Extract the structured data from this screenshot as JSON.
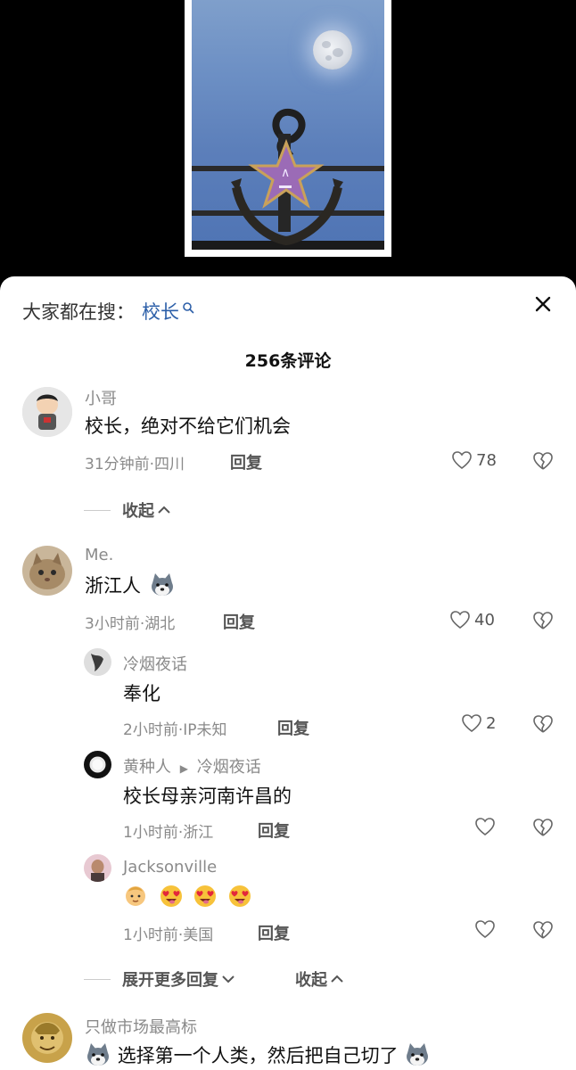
{
  "search": {
    "label": "大家都在搜：",
    "term": "校长"
  },
  "comments_title": "256条评论",
  "comments": [
    {
      "user": "小哥",
      "text": "校长，绝对不给它们机会",
      "time": "31分钟前·四川",
      "reply": "回复",
      "likes": "78",
      "collapse": "收起"
    },
    {
      "user": "Me.",
      "text": "浙江人",
      "time": "3小时前·湖北",
      "reply": "回复",
      "likes": "40",
      "replies": [
        {
          "user": "冷烟夜话",
          "text": "奉化",
          "time": "2小时前·IP未知",
          "reply": "回复",
          "likes": "2"
        },
        {
          "user": "黄种人",
          "reply_to": "冷烟夜话",
          "text": "校长母亲河南许昌的",
          "time": "1小时前·浙江",
          "reply": "回复",
          "likes": ""
        },
        {
          "user": "Jacksonville",
          "text": "",
          "time": "1小时前·美国",
          "reply": "回复",
          "likes": ""
        }
      ],
      "expand_more": "展开更多回复",
      "collapse": "收起"
    },
    {
      "user": "只做市场最高标",
      "text": "选择第一个人类，然后把自己切了"
    }
  ],
  "icons": {
    "close": "close-icon",
    "search_mini": "search-icon",
    "heart": "heart-icon",
    "dislike": "broken-heart-icon",
    "chevron_up": "chevron-up-icon",
    "chevron_down": "chevron-down-icon",
    "husky": "husky-emoji",
    "baby": "baby-emoji",
    "heart_eyes": "heart-eyes-emoji"
  },
  "colors": {
    "link_blue": "#2c5fa8",
    "muted": "#8a8a8a",
    "sheet_bg": "#ffffff"
  }
}
